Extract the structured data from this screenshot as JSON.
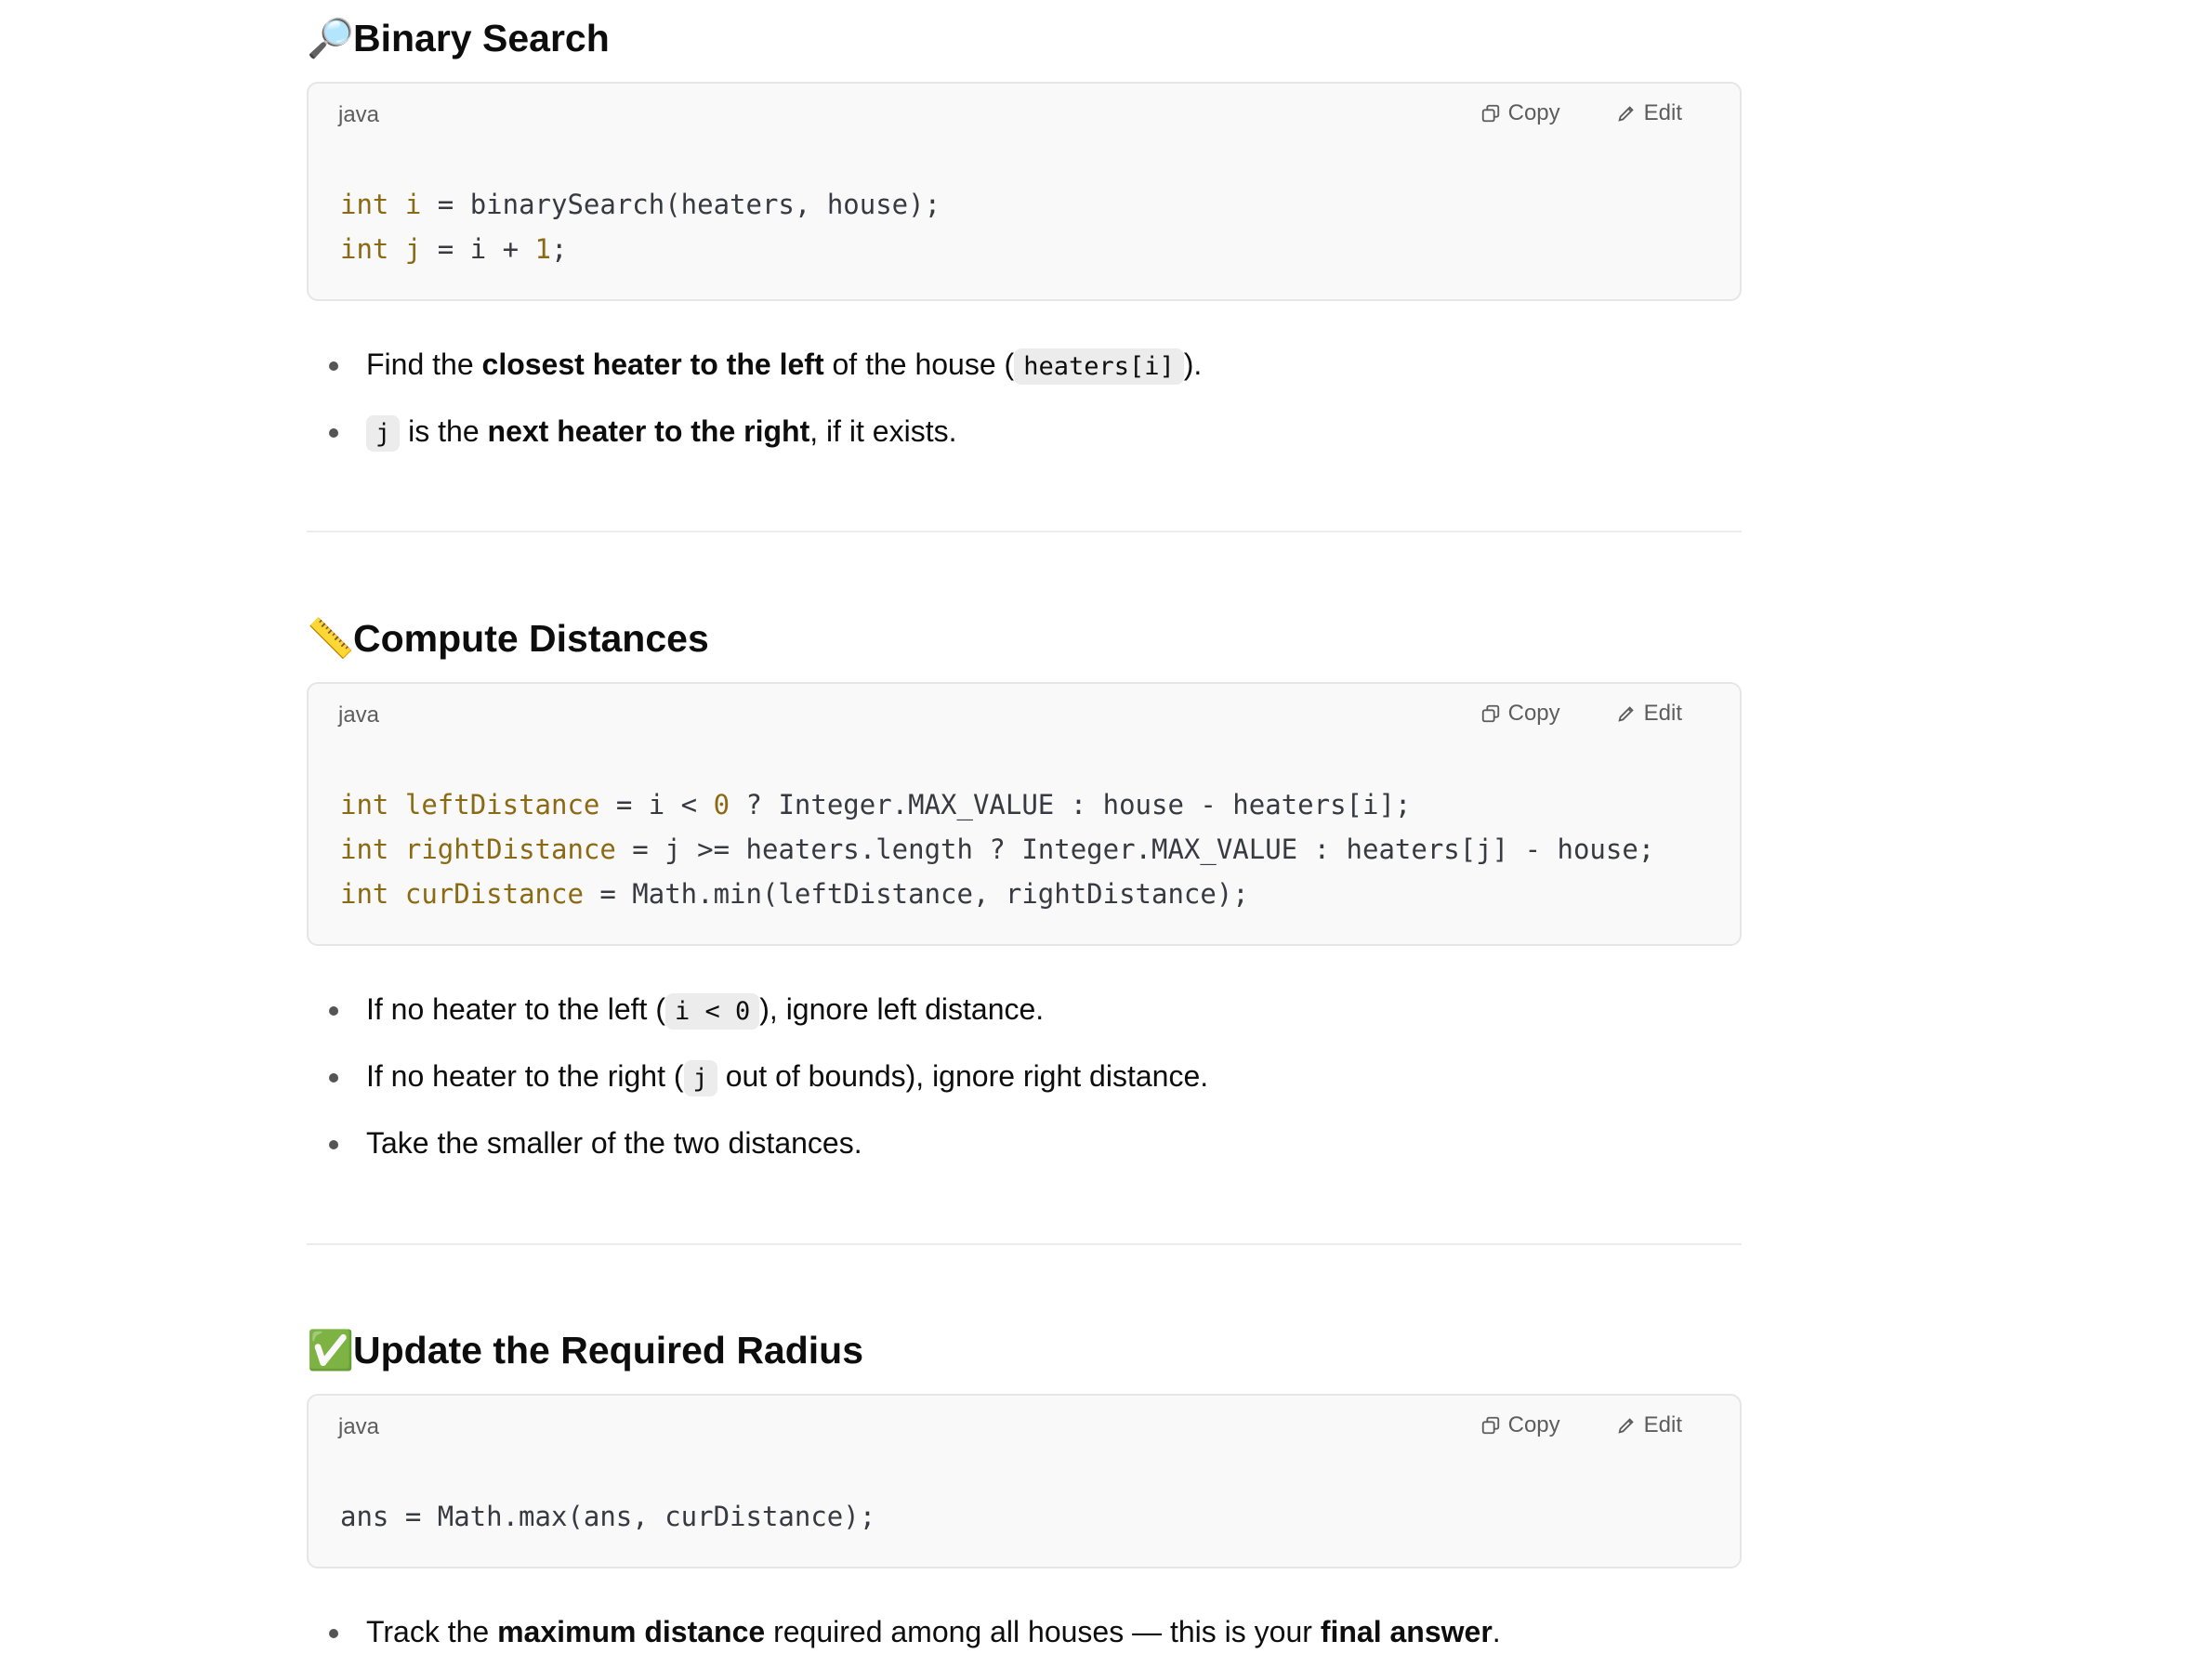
{
  "sections": [
    {
      "emoji": "🔎",
      "title": "Binary Search",
      "code": {
        "lang": "java",
        "copy_label": "Copy",
        "edit_label": "Edit",
        "lines": [
          "int i = binarySearch(heaters, house);",
          "int j = i + 1;"
        ]
      },
      "bullets": [
        "Find the closest heater to the left of the house ( heaters[i] ).",
        "j is the next heater to the right, if it exists."
      ]
    },
    {
      "emoji": "📏",
      "title": "Compute Distances",
      "code": {
        "lang": "java",
        "copy_label": "Copy",
        "edit_label": "Edit",
        "lines": [
          "int leftDistance = i < 0 ? Integer.MAX_VALUE : house - heaters[i];",
          "int rightDistance = j >= heaters.length ? Integer.MAX_VALUE : heaters[j] - house;",
          "int curDistance = Math.min(leftDistance, rightDistance);"
        ]
      },
      "bullets": [
        "If no heater to the left ( i < 0 ), ignore left distance.",
        "If no heater to the right ( j out of bounds), ignore right distance.",
        "Take the smaller of the two distances."
      ]
    },
    {
      "emoji": "✅",
      "title": "Update the Required Radius",
      "code": {
        "lang": "java",
        "copy_label": "Copy",
        "edit_label": "Edit",
        "lines": [
          "ans = Math.max(ans, curDistance);"
        ]
      },
      "bullets": [
        "Track the maximum distance required among all houses — this is your final answer."
      ]
    }
  ],
  "inline_parts": {
    "s0b0": [
      "Find the ",
      "closest heater to the left",
      " of the house (",
      "heaters[i]",
      ")."
    ],
    "s0b1": [
      "j",
      " is the ",
      "next heater to the right",
      ", if it exists."
    ],
    "s1b0": [
      "If no heater to the left (",
      "i < 0",
      "), ignore left distance."
    ],
    "s1b1": [
      "If no heater to the right (",
      "j",
      " out of bounds), ignore right distance."
    ],
    "s1b2": [
      "Take the smaller of the two distances."
    ],
    "s2b0": [
      "Track the ",
      "maximum distance",
      " required among all houses — this is your ",
      "final answer",
      "."
    ]
  },
  "code_tokens": {
    "s0": [
      [
        [
          "kw",
          "int"
        ],
        [
          "t",
          " "
        ],
        [
          "var",
          "i"
        ],
        [
          "t",
          " = binarySearch(heaters, house);"
        ]
      ],
      [
        [
          "kw",
          "int"
        ],
        [
          "t",
          " "
        ],
        [
          "var",
          "j"
        ],
        [
          "t",
          " = i + "
        ],
        [
          "num",
          "1"
        ],
        [
          "t",
          ";"
        ]
      ]
    ],
    "s1": [
      [
        [
          "kw",
          "int"
        ],
        [
          "t",
          " "
        ],
        [
          "var",
          "leftDistance"
        ],
        [
          "t",
          " = i < "
        ],
        [
          "num",
          "0"
        ],
        [
          "t",
          " ? Integer.MAX_VALUE : house - heaters[i];"
        ]
      ],
      [
        [
          "kw",
          "int"
        ],
        [
          "t",
          " "
        ],
        [
          "var",
          "rightDistance"
        ],
        [
          "t",
          " = j >= heaters.length ? Integer.MAX_VALUE : heaters[j] - house;"
        ]
      ],
      [
        [
          "kw",
          "int"
        ],
        [
          "t",
          " "
        ],
        [
          "var",
          "curDistance"
        ],
        [
          "t",
          " = Math.min(leftDistance, rightDistance);"
        ]
      ]
    ],
    "s2": [
      [
        [
          "t",
          "ans = Math.max(ans, curDistance);"
        ]
      ]
    ]
  }
}
